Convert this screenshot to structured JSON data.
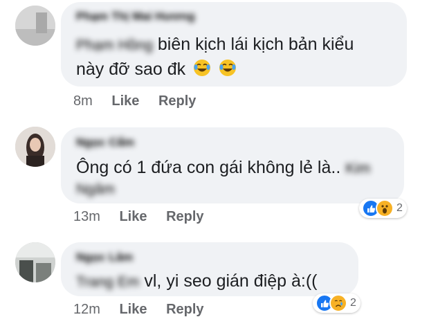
{
  "comments": [
    {
      "author": "Phạm Thị Mai Hương",
      "tag": "Phạm Hồng",
      "text": "biên kịch lái kịch bản kiểu",
      "text2": "này đỡ sao đk",
      "emojis": [
        "face-with-tears-of-joy-icon",
        "face-with-tears-of-joy-icon"
      ],
      "time": "8m",
      "like": "Like",
      "reply": "Reply"
    },
    {
      "author": "Ngọc Cẩm",
      "text": "Ông có 1 đứa con gái không lẻ là..",
      "tag": "Kim",
      "tag2": "Ngâm",
      "time": "13m",
      "like": "Like",
      "reply": "Reply",
      "reactions": [
        "like-icon",
        "wow-icon"
      ],
      "reaction_count": "2"
    },
    {
      "author": "Ngọc Lâm",
      "tag": "Trang Em",
      "text": "vl, yi seo gián điệp à:((",
      "time": "12m",
      "like": "Like",
      "reply": "Reply",
      "reactions": [
        "like-icon",
        "sad-icon"
      ],
      "reaction_count": "2"
    }
  ],
  "colors": {
    "bubble": "#f0f2f5",
    "meta_text": "#65676b",
    "like_blue": "#1877f2",
    "reaction_yellow": "#f7b125"
  }
}
